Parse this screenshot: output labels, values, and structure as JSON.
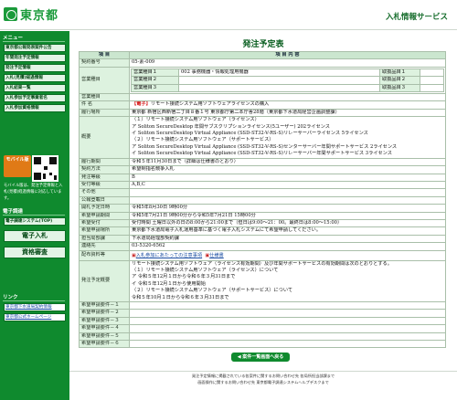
{
  "header": {
    "logo": "東京都",
    "service_title": "入札情報サービス"
  },
  "sidebar": {
    "menu_heading": "メニュー",
    "top_items": [
      "東京都公報発表案件公告",
      "年間発注予定情報",
      "発注予定情報",
      "入札(見積)経過情報",
      "入札結果一覧",
      "入札参加予定事業者名",
      "入札参加資格情報"
    ],
    "mobile_label": "モバイル版",
    "mobile_text": "モバイル版は、発注予定情報と入札(見積)経過情報に対応しています。",
    "tools_heading": "電子調達",
    "tools_items": [
      "電子調達システム(TOP)",
      "電子入札",
      "資格審査"
    ],
    "links_heading": "リンク",
    "links_items": [
      "東京都下水道局契約情報",
      "東京都公式ホームページ"
    ]
  },
  "page_title": "発注予定表",
  "table": {
    "head_item": "項 目",
    "head_content": "項 目 内 容",
    "rows": [
      {
        "label": "契約番号",
        "value": "05-素-009"
      },
      {
        "label": "営業種目",
        "value": ""
      },
      {
        "label": "営業種目",
        "value": ""
      },
      {
        "label": "件 名",
        "tag": "【電子】",
        "value": "リモート接続システム用ソフトウェアライセンスの購入"
      },
      {
        "label": "履行場所",
        "value": "東京都 新宿区西新宿二丁目８番１号 東京都庁第二本庁舎28階（東京都下水道局経営企画調整課）"
      },
      {
        "label": "概要",
        "lines": [
          "（１）リモート接続システム用ソフトウェア（ライセンス）",
          "ア Soliton SecureDesktop 年間サブスクリプションライセンス(5ユーザー) 202ライセンス",
          "イ Soliton SecureDesktop Virtual Appliance (SSD-ST32-V-RS-S)リレーサーバーライセンス 5ライセンス",
          "（２）リモート接続システム用ソフトウェア（サポートサービス）",
          "ア Soliton SecureDesktop Virtual Appliance (SSD-ST32-V-RS-S)センターサーバー年間サポートサービス 2ライセンス",
          "イ Soliton SecureDesktop Virtual Appliance (SSD-ST32-V-RS-S)リレーサーバー年間サポートサービス 3ライセンス"
        ]
      },
      {
        "label": "履行期間",
        "value": "令和５年11月30日まで（詳細は仕様書のとおり）"
      },
      {
        "label": "契約方法",
        "value": "希望制指名競争入札"
      },
      {
        "label": "発注等級",
        "value": "B"
      },
      {
        "label": "受付等級",
        "value": "A,B,C"
      },
      {
        "label": "その他",
        "value": ""
      },
      {
        "label": "公報登載日",
        "value": ""
      },
      {
        "label": "開札予定日時",
        "value": "令和5年8月30日 9時00分"
      },
      {
        "label": "希望申請期間",
        "value": "令和5年7月21日 9時00分から令和5年7月21日 15時00分"
      },
      {
        "label": "希望受付",
        "value": "受付時間 土曜日以外の日の8:00から21:00まで（但日は9:00～21：00。最終日は8:00～15:00）"
      },
      {
        "label": "希望申請場所",
        "value": "東京都下水道局電子入札運用基準に基づく電子入札システムにて希望申請してください。"
      },
      {
        "label": "担当局部課",
        "value": "下水道局経理部契約課"
      },
      {
        "label": "連絡先",
        "value": "03-5320-6562"
      },
      {
        "label": "配布資料等",
        "value": ""
      },
      {
        "label": "発注予定概要",
        "lines": [
          "リモート接続システム用ソフトウェア（ライセンス有効期間）及び年間サポートサービスの有効期間は次のとおりとする。",
          "（１）リモート接続システム用ソフトウェア（ライセンス）について",
          "ア 令和５年12月１日から令和６年３月31日まで",
          "イ 令和５年12月１日から使用開始",
          "（２）リモート接続システム用ソフトウェア（サポートサービス）について",
          "令和５年10月１日から令和６年３月31日まで"
        ]
      },
      {
        "label": "希望申請要件－１",
        "value": ""
      },
      {
        "label": "希望申請要件－２",
        "value": ""
      },
      {
        "label": "希望申請要件－３",
        "value": ""
      },
      {
        "label": "希望申請要件－４",
        "value": ""
      },
      {
        "label": "希望申請要件－５",
        "value": ""
      },
      {
        "label": "希望申請要件－６",
        "value": ""
      }
    ],
    "eigyo": [
      [
        "営業種目１",
        "002 事務機器・情報処理用機器",
        "取扱品目１",
        ""
      ],
      [
        "営業種目２",
        "",
        "取扱品目２",
        ""
      ],
      [
        "営業種目３",
        "",
        "取扱品目３",
        ""
      ]
    ],
    "downloads": [
      "入札参加にあたっての注意事項",
      "仕様書"
    ]
  },
  "back_button": "案件一覧画面へ戻る",
  "footer": {
    "line1": "発注予定情報に掲載されている各案件に関するお問い合わせ先 各局所担当部課まで",
    "line2": "画面操作に関するお問い合わせ先 東京都電子調達システムヘルプデスクまで"
  }
}
